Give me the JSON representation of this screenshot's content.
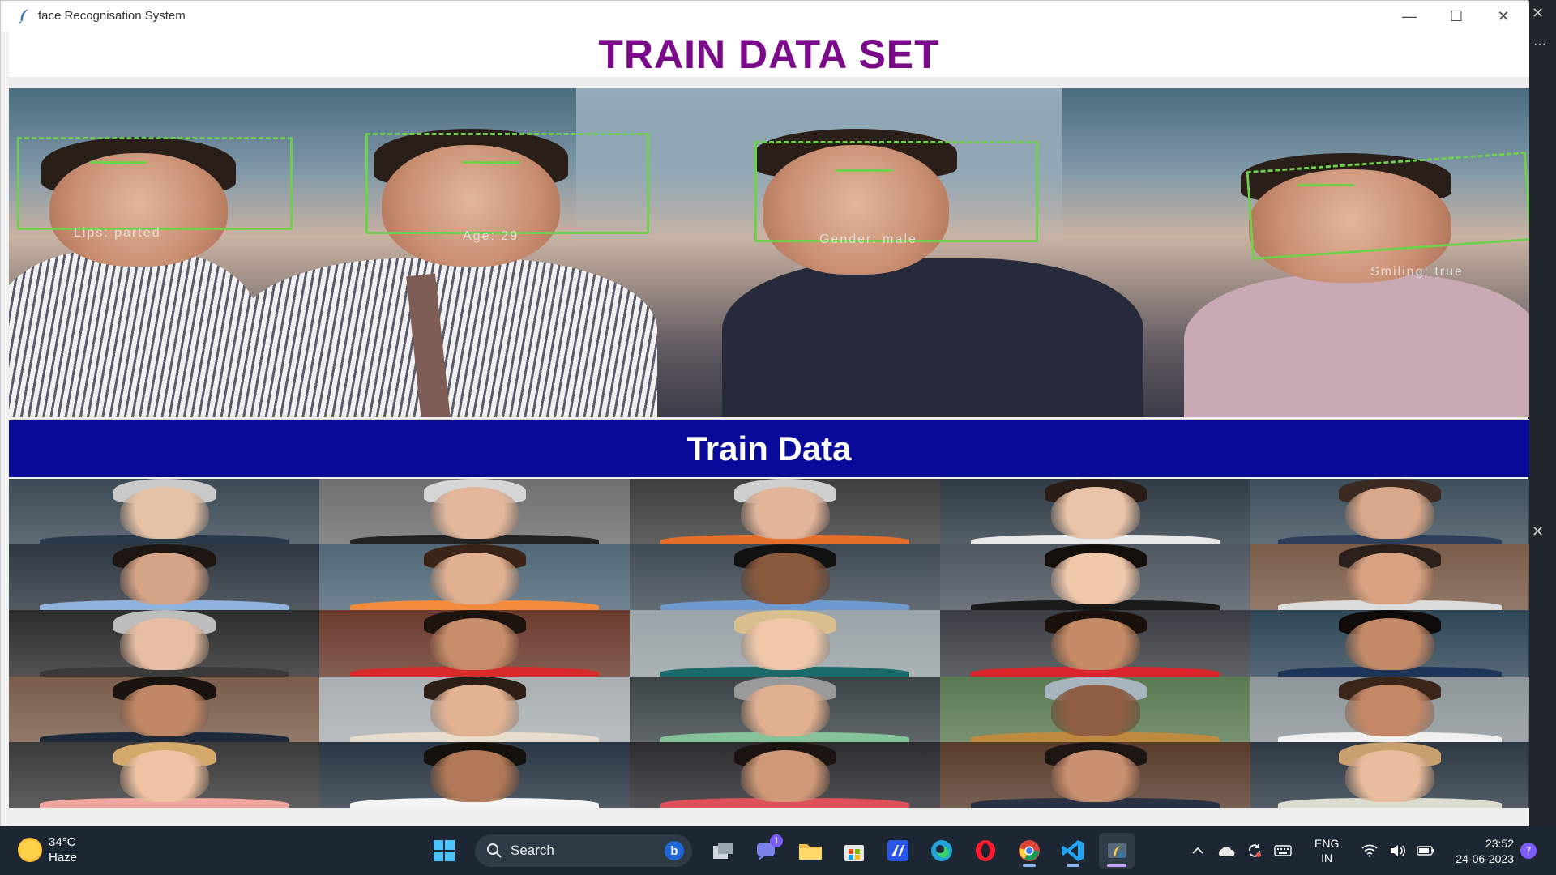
{
  "window": {
    "title": "face Recognisation System",
    "min_glyph": "—",
    "max_glyph": "☐",
    "close_glyph": "✕"
  },
  "header": {
    "title": "TRAIN DATA SET"
  },
  "hero": {
    "labels": [
      "Lips: parted",
      "Age: 29",
      "Gender: male",
      "Smiling: true"
    ]
  },
  "banner": {
    "title": "Train Data"
  },
  "grid": {
    "rows": 5,
    "cols": 5,
    "cells": [
      {
        "bg": "#3b4a56",
        "skin": "#e6c2a6",
        "hair": "#c9c9c9",
        "shirt": "#2b3a4a"
      },
      {
        "bg": "#6f6f6f",
        "skin": "#e3b79c",
        "hair": "#d6d6d6",
        "shirt": "#222"
      },
      {
        "bg": "#3e3e3e",
        "skin": "#e2b49a",
        "hair": "#cfcfcf",
        "shirt": "#e56f2a"
      },
      {
        "bg": "#2f3b46",
        "skin": "#eac4a9",
        "hair": "#2a1c16",
        "shirt": "#e8e8e8"
      },
      {
        "bg": "#3e4f5c",
        "skin": "#d9a88a",
        "hair": "#3a2a22",
        "shirt": "#2c3e5a"
      },
      {
        "bg": "#2e3640",
        "skin": "#d6a486",
        "hair": "#1e1612",
        "shirt": "#8fb4e0"
      },
      {
        "bg": "#506878",
        "skin": "#e0b090",
        "hair": "#3a2418",
        "shirt": "#f28c3c"
      },
      {
        "bg": "#404a54",
        "skin": "#8a5a3e",
        "hair": "#111",
        "shirt": "#6f9ad0"
      },
      {
        "bg": "#4e5660",
        "skin": "#f0c8ac",
        "hair": "#150f0c",
        "shirt": "#1a1a1a"
      },
      {
        "bg": "#7a5c48",
        "skin": "#d9a283",
        "hair": "#2a1f1a",
        "shirt": "#dcdcdc"
      },
      {
        "bg": "#2b2b2b",
        "skin": "#e7bea3",
        "hair": "#bdbdbd",
        "shirt": "#3a3a3a"
      },
      {
        "bg": "#6a3a2c",
        "skin": "#c88e6c",
        "hair": "#1e140f",
        "shirt": "#d82a2a"
      },
      {
        "bg": "#9aa3a8",
        "skin": "#f0c7a8",
        "hair": "#d9c08e",
        "shirt": "#1a6a6a"
      },
      {
        "bg": "#3a3e44",
        "skin": "#c68b66",
        "hair": "#1a110c",
        "shirt": "#d8242a"
      },
      {
        "bg": "#2e4656",
        "skin": "#c48a68",
        "hair": "#0f0b08",
        "shirt": "#1d3558"
      },
      {
        "bg": "#7a5c4a",
        "skin": "#c08866",
        "hair": "#1a130f",
        "shirt": "#1e2a3a"
      },
      {
        "bg": "#aab0b2",
        "skin": "#e3b292",
        "hair": "#2c1e14",
        "shirt": "#e8dccc"
      },
      {
        "bg": "#3c4448",
        "skin": "#e0b090",
        "hair": "#9a9a9a",
        "shirt": "#86c29a"
      },
      {
        "bg": "#5a7a52",
        "skin": "#8f5e44",
        "hair": "#a8b4be",
        "shirt": "#c08a3e"
      },
      {
        "bg": "#8e969a",
        "skin": "#c48866",
        "hair": "#3a2518",
        "shirt": "#f0f0f0"
      },
      {
        "bg": "#3a3a3a",
        "skin": "#eec2a2",
        "hair": "#d4a96a",
        "shirt": "#f2a6a0"
      },
      {
        "bg": "#2a3644",
        "skin": "#b07856",
        "hair": "#14100c",
        "shirt": "#f4f4f4"
      },
      {
        "bg": "#2b2b30",
        "skin": "#d09a78",
        "hair": "#1c1410",
        "shirt": "#e0505a"
      },
      {
        "bg": "#5a3c2c",
        "skin": "#c89070",
        "hair": "#1e1612",
        "shirt": "#2a3346"
      },
      {
        "bg": "#2c3844",
        "skin": "#e8bc9c",
        "hair": "#c8a070",
        "shirt": "#dcdcd0"
      }
    ]
  },
  "taskbar": {
    "weather": {
      "temp": "34°C",
      "desc": "Haze"
    },
    "search": {
      "label": "Search",
      "bing": "b"
    },
    "teams_badge": "1",
    "tray": {
      "lang_line1": "ENG",
      "lang_line2": "IN"
    },
    "clock": {
      "time": "23:52",
      "date": "24-06-2023"
    },
    "notifications": "7"
  },
  "background": {
    "dots": "···",
    "close_glyph_1": "✕",
    "close_glyph_2": "✕"
  },
  "colors": {
    "title_purple": "#7a0a8a",
    "banner_blue": "#0a0a9a",
    "detection_green": "#6ed14a",
    "taskbar": "#1c2733"
  }
}
